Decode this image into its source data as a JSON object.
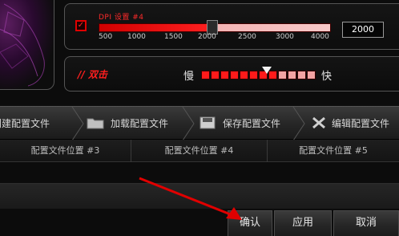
{
  "dpi": {
    "title": "DPI 设置 #4",
    "checked": true,
    "ticks": [
      "500",
      "1000",
      "1500",
      "2000",
      "2500",
      "3000",
      "4000"
    ],
    "value": "2000"
  },
  "double_click": {
    "label": "// 双击",
    "slow_label": "慢",
    "fast_label": "快",
    "level": 0.65
  },
  "toolbar": {
    "new_profile": "创建配置文件",
    "load_profile": "加载配置文件",
    "save_profile": "保存配置文件",
    "edit_profile": "编辑配置文件"
  },
  "profiles": [
    {
      "label": "配置文件位置 #3"
    },
    {
      "label": "配置文件位置 #4"
    },
    {
      "label": "配置文件位置 #5"
    }
  ],
  "buttons": {
    "ok": "确认",
    "apply": "应用",
    "cancel": "取消"
  },
  "colors": {
    "accent": "#ff1f1f",
    "arrow": "#e00000"
  }
}
